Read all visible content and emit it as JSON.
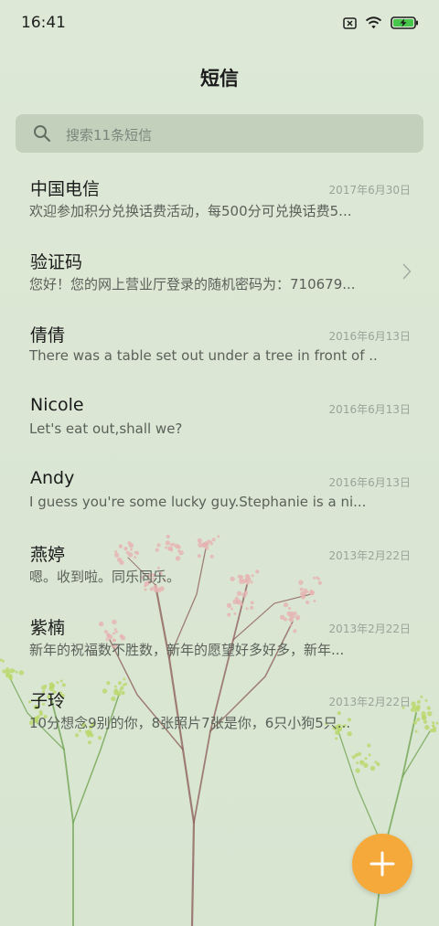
{
  "status_bar": {
    "time": "16:41",
    "icons": [
      "sim-error-icon",
      "wifi-icon",
      "battery-charging-icon"
    ]
  },
  "header": {
    "title": "短信"
  },
  "search": {
    "placeholder": "搜索11条短信",
    "icon": "search-icon"
  },
  "messages": [
    {
      "name": "中国电信",
      "date": "2017年6月30日",
      "preview": "欢迎参加积分兑换话费活动，每500分可兑换话费5..."
    },
    {
      "name": "验证码",
      "date": "",
      "preview": "您好！您的网上营业厅登录的随机密码为：710679...",
      "icon": "chevron-right-icon"
    },
    {
      "name": "倩倩",
      "date": "2016年6月13日",
      "preview": "There was a table set out under a tree in front of ..."
    },
    {
      "name": "Nicole",
      "date": "2016年6月13日",
      "preview": "Let's eat out,shall we?"
    },
    {
      "name": "Andy",
      "date": "2016年6月13日",
      "preview": "I guess you're some lucky guy.Stephanie is a ni..."
    },
    {
      "name": "燕婷",
      "date": "2013年2月22日",
      "preview": "嗯。收到啦。同乐同乐。"
    },
    {
      "name": "紫楠",
      "date": "2013年2月22日",
      "preview": "新年的祝福数不胜数，新年的愿望好多好多，新年..."
    },
    {
      "name": "子玲",
      "date": "2013年2月22日",
      "preview": "10分想念9别的你，8张照片7张是你，6只小狗5只..."
    }
  ],
  "fab": {
    "icon": "plus-icon",
    "color": "#f5a93a"
  },
  "colors": {
    "background": "#dbe7d4",
    "search_bg": "#bcc8b8",
    "accent": "#f5a93a",
    "stem_brown": "#8a5a55",
    "stem_green": "#6aa04a",
    "flower_pink": "#e6b3b3",
    "flower_green": "#b9d86a"
  }
}
